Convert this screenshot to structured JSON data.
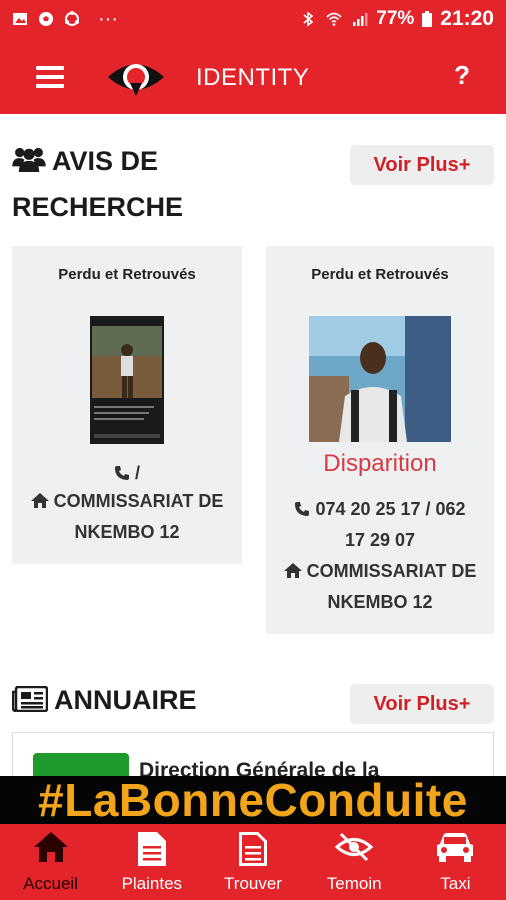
{
  "status_bar": {
    "battery": "77%",
    "time": "21:20",
    "dots": "···"
  },
  "app_bar": {
    "title": "IDENTITY",
    "help": "?"
  },
  "avis": {
    "title_line1": "AVIS DE",
    "title_line2": "RECHERCHE",
    "voir_plus": "Voir Plus+",
    "cards": [
      {
        "category": "Perdu et Retrouvés",
        "phone": "/",
        "location_line1": "COMMISSARIAT DE",
        "location_line2": "NKEMBO 12"
      },
      {
        "category": "Perdu et Retrouvés",
        "type_label": "Disparition",
        "phone_line1": "074 20 25 17 / 062",
        "phone_line2": "17 29 07",
        "location_line1": "COMMISSARIAT DE",
        "location_line2": "NKEMBO 12"
      }
    ]
  },
  "annuaire": {
    "title": "ANNUAIRE",
    "voir_plus": "Voir Plus+",
    "first_entry": "Direction Générale de la"
  },
  "banner": {
    "hashtag": "#LaBonneConduite"
  },
  "bottom_nav": [
    {
      "label": "Accueil",
      "icon": "home-icon"
    },
    {
      "label": "Plaintes",
      "icon": "document-icon"
    },
    {
      "label": "Trouver",
      "icon": "file-icon"
    },
    {
      "label": "Temoin",
      "icon": "eye-slash-icon"
    },
    {
      "label": "Taxi",
      "icon": "car-icon"
    }
  ],
  "colors": {
    "primary": "#e3242b",
    "accent_text": "#d11f26",
    "banner_text": "#f2a51a"
  }
}
